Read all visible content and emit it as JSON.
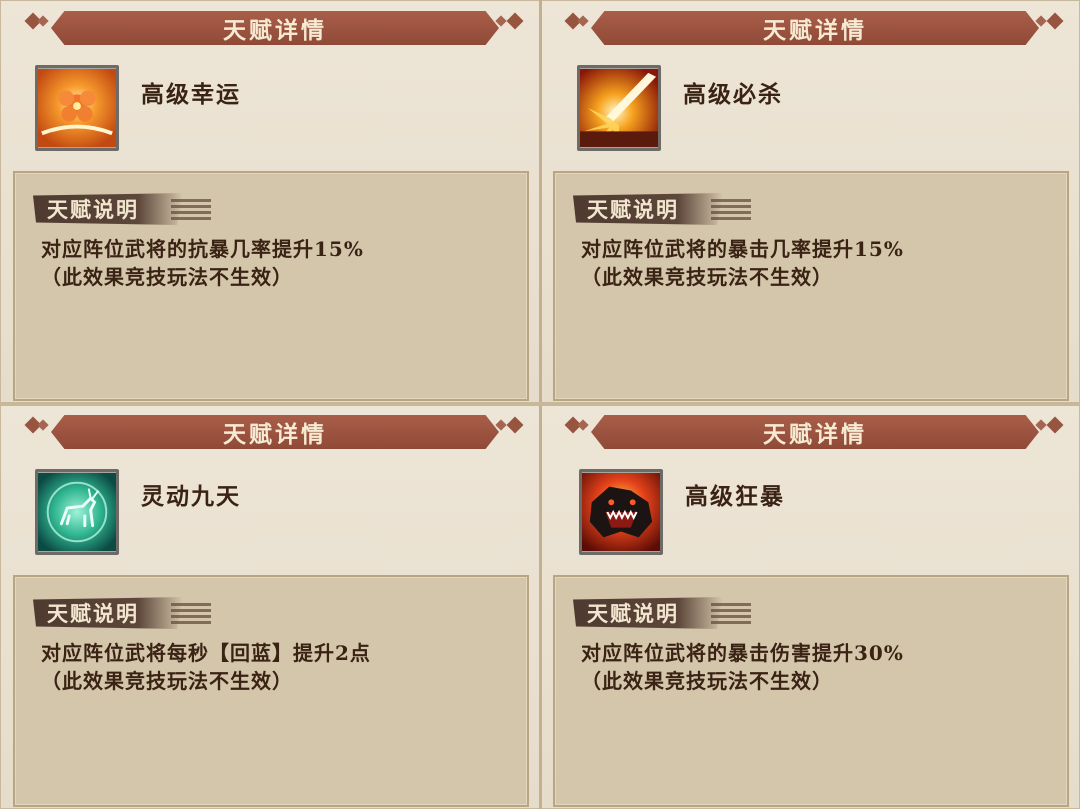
{
  "panels": [
    {
      "header_title": "天赋详情",
      "icon": "fire-flower-icon",
      "skill_name": "高级幸运",
      "section_label": "天赋说明",
      "desc_line1": "对应阵位武将的抗暴几率提升15%",
      "desc_line2": "（此效果竞技玩法不生效）"
    },
    {
      "header_title": "天赋详情",
      "icon": "critical-slash-icon",
      "skill_name": "高级必杀",
      "section_label": "天赋说明",
      "desc_line1": "对应阵位武将的暴击几率提升15%",
      "desc_line2": "（此效果竞技玩法不生效）"
    },
    {
      "header_title": "天赋详情",
      "icon": "spirit-deer-icon",
      "skill_name": "灵动九天",
      "section_label": "天赋说明",
      "desc_line1": "对应阵位武将每秒【回蓝】提升2点",
      "desc_line2": "（此效果竞技玩法不生效）"
    },
    {
      "header_title": "天赋详情",
      "icon": "beast-fury-icon",
      "skill_name": "高级狂暴",
      "section_label": "天赋说明",
      "desc_line1": "对应阵位武将的暴击伤害提升30%",
      "desc_line2": "（此效果竞技玩法不生效）"
    }
  ],
  "colors": {
    "ribbon": "#9a5340",
    "ribbon_text": "#f6ead2",
    "panel_bg": "#ebe2d2",
    "desc_box_bg": "#d4c6aa",
    "tag_bg": "#4e3a30",
    "body_text": "#3a2315"
  }
}
